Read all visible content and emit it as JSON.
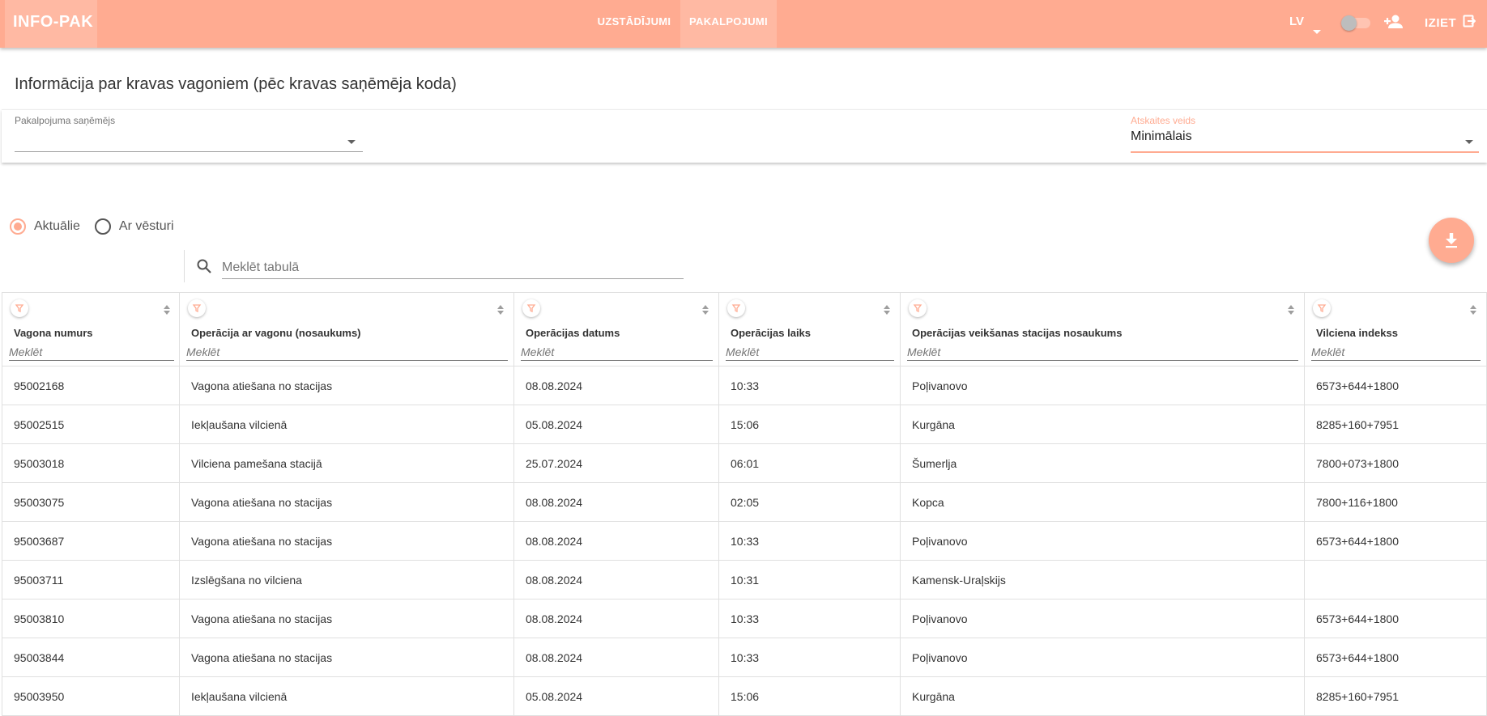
{
  "header": {
    "logo": "INFO-PAK",
    "nav": [
      {
        "label": "UZSTĀDĪJUMI"
      },
      {
        "label": "PAKALPOJUMI"
      }
    ],
    "language": "LV",
    "logout_label": "IZIET"
  },
  "page": {
    "title": "Informācija par kravas vagoniem (pēc kravas saņēmēja koda)"
  },
  "filters": {
    "recipient_label": "Pakalpojuma saņēmējs",
    "recipient_value": "",
    "report_type_label": "Atskaites veids",
    "report_type_value": "Minimālais"
  },
  "mode": {
    "options": [
      {
        "label": "Aktuālie",
        "checked": true
      },
      {
        "label": "Ar vēsturi",
        "checked": false
      }
    ]
  },
  "search": {
    "placeholder": "Meklēt tabulā"
  },
  "colors": {
    "accent": "#ffab91",
    "accent_light": "#ffb9a3"
  },
  "table": {
    "column_search_placeholder": "Meklēt",
    "columns": [
      {
        "label": "Vagona numurs"
      },
      {
        "label": "Operācija ar vagonu (nosaukums)"
      },
      {
        "label": "Operācijas datums"
      },
      {
        "label": "Operācijas laiks"
      },
      {
        "label": "Operācijas veikšanas stacijas nosaukums"
      },
      {
        "label": "Vilciena indekss"
      }
    ],
    "rows": [
      [
        "95002168",
        "Vagona atiešana no stacijas",
        "08.08.2024",
        "10:33",
        "Poļivanovo",
        "6573+644+1800"
      ],
      [
        "95002515",
        "Iekļaušana vilcienā",
        "05.08.2024",
        "15:06",
        "Kurgāna",
        "8285+160+7951"
      ],
      [
        "95003018",
        "Vilciena pamešana stacijā",
        "25.07.2024",
        "06:01",
        "Šumerlja",
        "7800+073+1800"
      ],
      [
        "95003075",
        "Vagona atiešana no stacijas",
        "08.08.2024",
        "02:05",
        "Kopca",
        "7800+116+1800"
      ],
      [
        "95003687",
        "Vagona atiešana no stacijas",
        "08.08.2024",
        "10:33",
        "Poļivanovo",
        "6573+644+1800"
      ],
      [
        "95003711",
        "Izslēgšana no vilciena",
        "08.08.2024",
        "10:31",
        "Kamensk-Uraļskijs",
        ""
      ],
      [
        "95003810",
        "Vagona atiešana no stacijas",
        "08.08.2024",
        "10:33",
        "Poļivanovo",
        "6573+644+1800"
      ],
      [
        "95003844",
        "Vagona atiešana no stacijas",
        "08.08.2024",
        "10:33",
        "Poļivanovo",
        "6573+644+1800"
      ],
      [
        "95003950",
        "Iekļaušana vilcienā",
        "05.08.2024",
        "15:06",
        "Kurgāna",
        "8285+160+7951"
      ]
    ]
  }
}
